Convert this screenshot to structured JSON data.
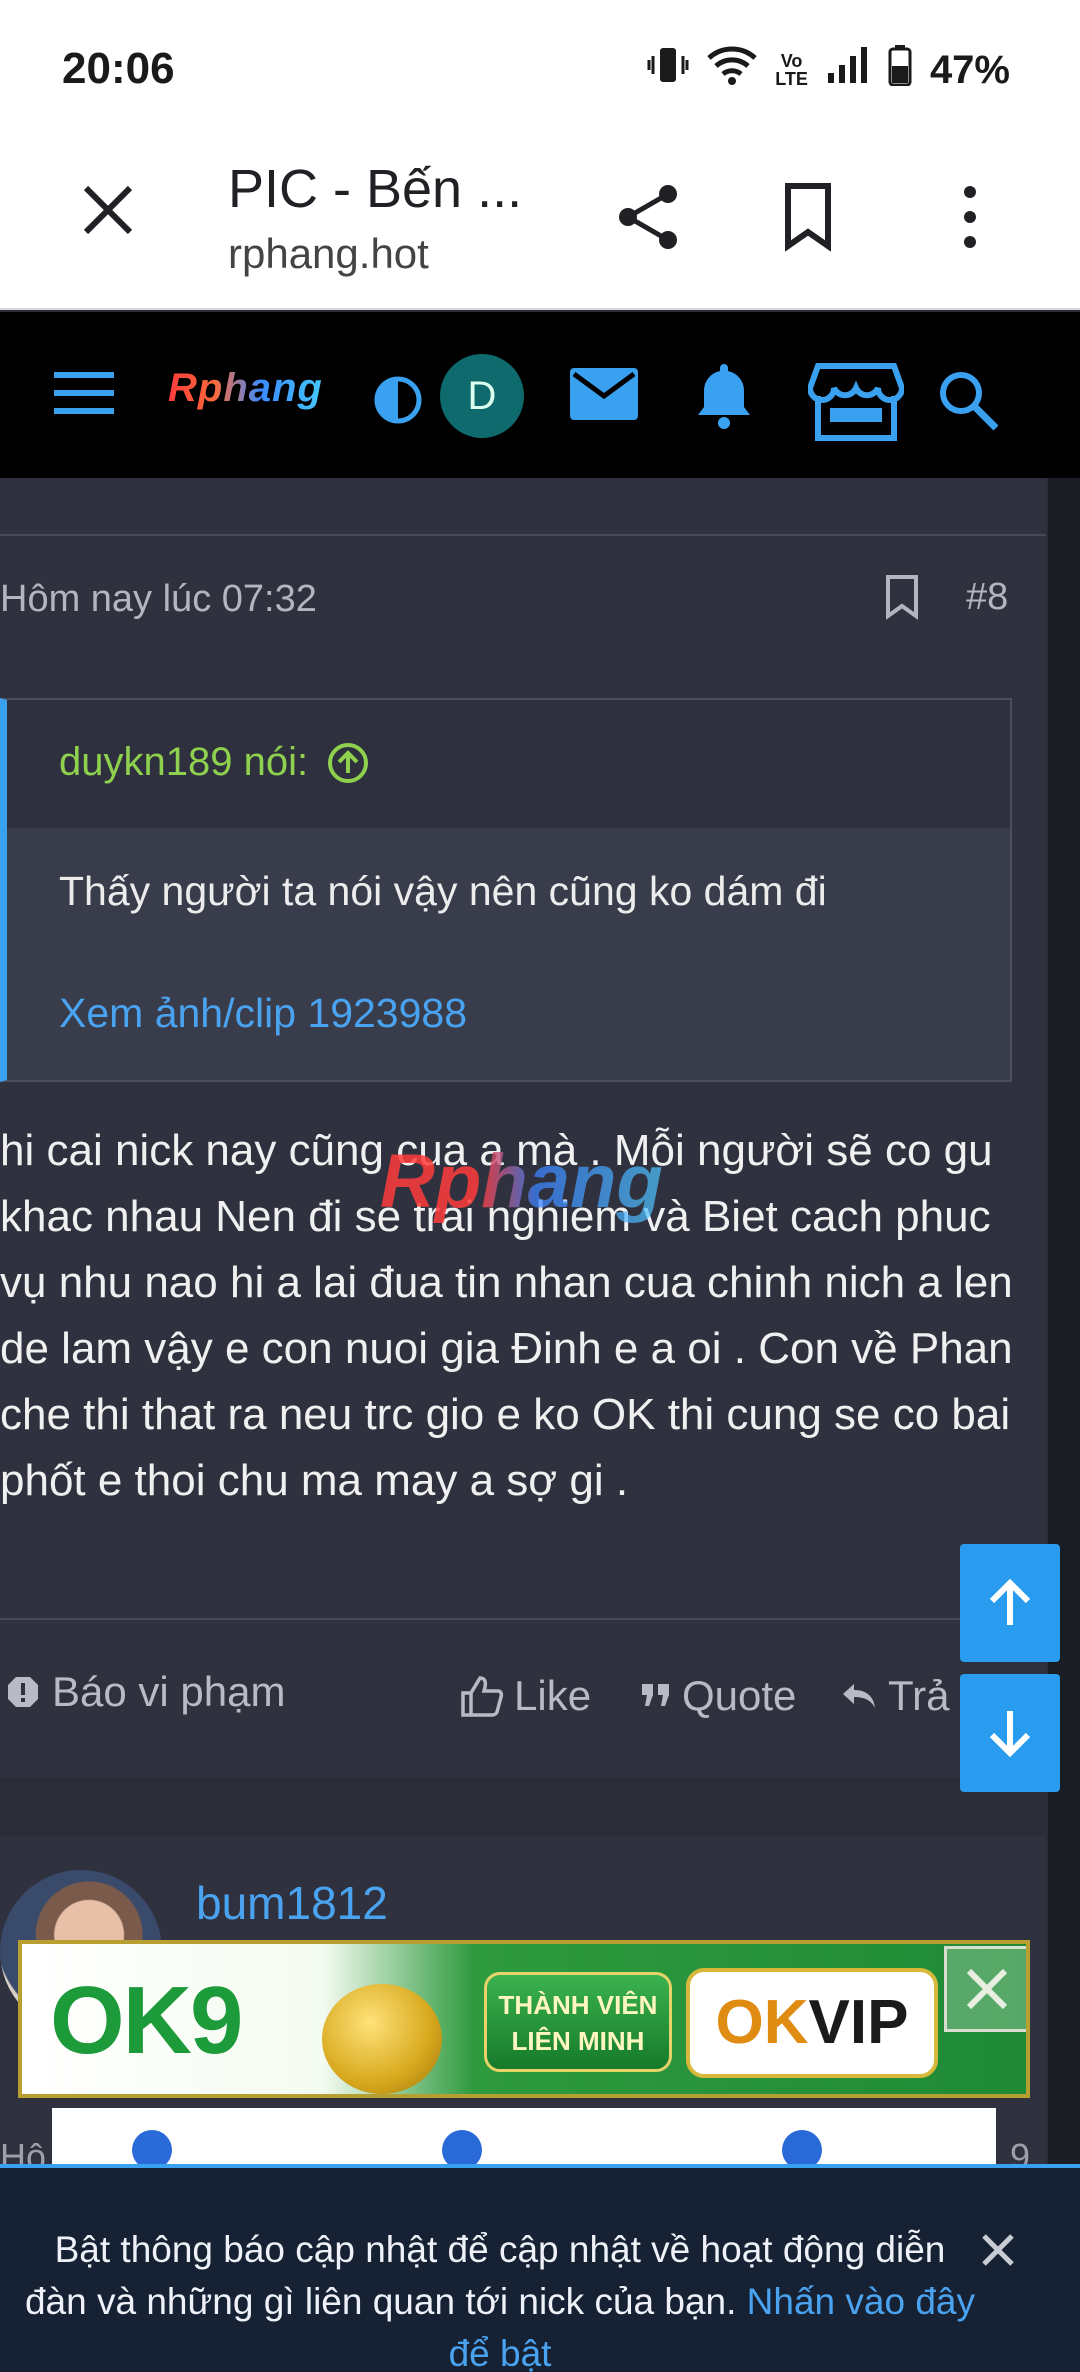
{
  "status_bar": {
    "time": "20:06",
    "battery": "47%",
    "volte_top": "Vo",
    "volte_bottom": "LTE"
  },
  "browser": {
    "title": "PIC - Bến ...",
    "url": "rphang.hot"
  },
  "site": {
    "logo": "Rphang",
    "avatar_letter": "D"
  },
  "post": {
    "date": "Hôm nay lúc 07:32",
    "number": "#8",
    "quote": {
      "author": "duykn189 nói:",
      "text": "Thấy người ta nói vậy nên cũng ko dám đi",
      "link": "Xem ảnh/clip 1923988"
    },
    "body": "hi cai nick nay cũng cua a mà . Mỗi người sẽ co gu khac nhau Nen đi se trai nghiem và Biet cach phuc vụ nhu nao hi a lai đua tin nhan cua chinh nich a len de lam vậy e con nuoi gia Đinh e a oi . Con về Phan che thi that ra neu trc gio e ko OK thi cung se co bai phốt e thoi chu ma may a sợ gi .",
    "watermark": "Rphang",
    "actions": {
      "report": "Báo vi phạm",
      "like": "Like",
      "quote": "Quote",
      "reply": "Trả"
    }
  },
  "post2": {
    "username": "bum1812",
    "date_partial": "Hô",
    "number_partial": "9"
  },
  "ad": {
    "brand": "OK9",
    "member_line1": "THÀNH VIÊN",
    "member_line2": "LIÊN MINH",
    "vip_ok": "OK",
    "vip_text": "VIP"
  },
  "notification": {
    "message": "Bật thông báo cập nhật để cập nhật về hoạt động diễn đàn và những gì liên quan tới nick của bạn.",
    "link": "Nhấn vào đây để bật"
  },
  "colors": {
    "accent": "#2a9cf0",
    "quote_author": "#8fd14f",
    "link": "#4aa3f0",
    "navbar": "#000000",
    "page_bg": "#2f323e"
  }
}
